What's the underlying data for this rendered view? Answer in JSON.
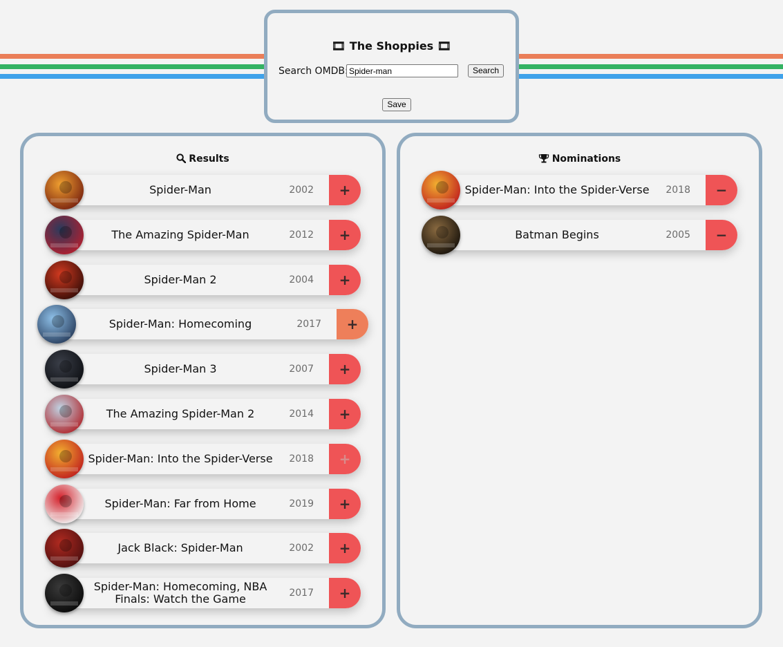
{
  "colors": {
    "stripe1": "#ea7e58",
    "stripe2": "#33b262",
    "stripe3": "#3fa2ea",
    "panel_border": "#91abc0",
    "action_button": "#ef5456",
    "action_button_hover": "#ee7f5a"
  },
  "header": {
    "title": "🎞 The Shoppies 🎞",
    "search_label": "Search OMDB:",
    "search_value": "Spider-man",
    "search_button": "Search",
    "save_button": "Save"
  },
  "results": {
    "title": "Results",
    "icon": "search-icon",
    "items": [
      {
        "title": "Spider-Man",
        "year": "2002",
        "action": "+",
        "poster_colors": [
          "#f0a030",
          "#7a2410"
        ]
      },
      {
        "title": "The Amazing Spider-Man",
        "year": "2012",
        "action": "+",
        "poster_colors": [
          "#2b3a5c",
          "#b02030"
        ]
      },
      {
        "title": "Spider-Man 2",
        "year": "2004",
        "action": "+",
        "poster_colors": [
          "#d23a20",
          "#3a0e08"
        ]
      },
      {
        "title": "Spider-Man: Homecoming",
        "year": "2017",
        "action": "+",
        "poster_colors": [
          "#8ec0e8",
          "#2a4060"
        ]
      },
      {
        "title": "Spider-Man 3",
        "year": "2007",
        "action": "+",
        "poster_colors": [
          "#3a3e48",
          "#0e1014"
        ]
      },
      {
        "title": "The Amazing Spider-Man 2",
        "year": "2014",
        "action": "+",
        "poster_colors": [
          "#c0d4e4",
          "#b02a30"
        ]
      },
      {
        "title": "Spider-Man: Into the Spider-Verse",
        "year": "2018",
        "action": "+",
        "poster_colors": [
          "#f2b030",
          "#c0201e"
        ]
      },
      {
        "title": "Spider-Man: Far from Home",
        "year": "2019",
        "action": "+",
        "poster_colors": [
          "#d4202a",
          "#f0f0f0"
        ]
      },
      {
        "title": "Jack Black: Spider-Man",
        "year": "2002",
        "action": "+",
        "poster_colors": [
          "#b02a20",
          "#501010"
        ]
      },
      {
        "title": "Spider-Man: Homecoming, NBA Finals: Watch the Game",
        "year": "2017",
        "action": "+",
        "poster_colors": [
          "#3a3a3a",
          "#0a0a0a"
        ]
      }
    ]
  },
  "nominations": {
    "title": "Nominations",
    "icon": "trophy-icon",
    "items": [
      {
        "title": "Spider-Man: Into the Spider-Verse",
        "year": "2018",
        "action": "−",
        "poster_colors": [
          "#f2b030",
          "#c0201e"
        ]
      },
      {
        "title": "Batman Begins",
        "year": "2005",
        "action": "−",
        "poster_colors": [
          "#8a6a40",
          "#1a140c"
        ]
      }
    ]
  }
}
